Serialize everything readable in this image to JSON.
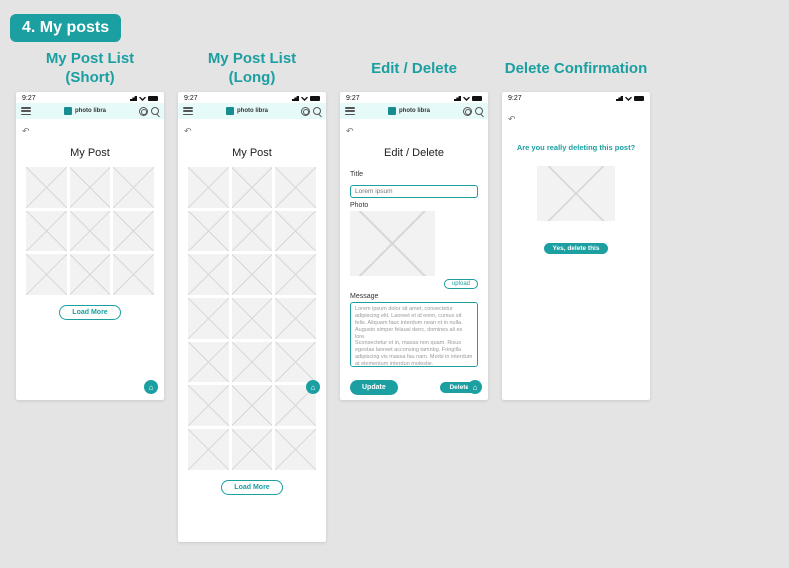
{
  "section_badge": "4. My posts",
  "brand_name": "photo libra",
  "status_time": "9:27",
  "columns": {
    "short": {
      "title": "My Post List\n(Short)",
      "screen_title": "My Post",
      "load_more": "Load More",
      "thumb_count": 9
    },
    "long": {
      "title": "My Post List\n(Long)",
      "screen_title": "My Post",
      "load_more": "Load More",
      "thumb_count": 21
    },
    "edit": {
      "title": "Edit / Delete",
      "screen_title": "Edit / Delete",
      "labels": {
        "title": "Title",
        "photo": "Photo",
        "message": "Message"
      },
      "title_placeholder": "Lorem ipsum",
      "upload_label": "upload",
      "message_text": "Lorem ipsum dolor sit amet, consectetur adipiscing elit. Laoreet et id enim, cursus sit felis. Aliquam fauc interdum nean nt in nulla. Augusto simper felausi denc, domines ali es lore.\nSconsectetur et in, massa non quam. Risus egestas laoreet acconsing tamnbg. Fringilla adipiscing vis massa fau nam. Morbi in interdum at elementum interdun molestie.",
      "update_label": "Update",
      "delete_label": "Delete"
    },
    "confirm": {
      "title": "Delete Confirmation",
      "question": "Are you really deleting this post?",
      "confirm_label": "Yes, delete this"
    }
  }
}
